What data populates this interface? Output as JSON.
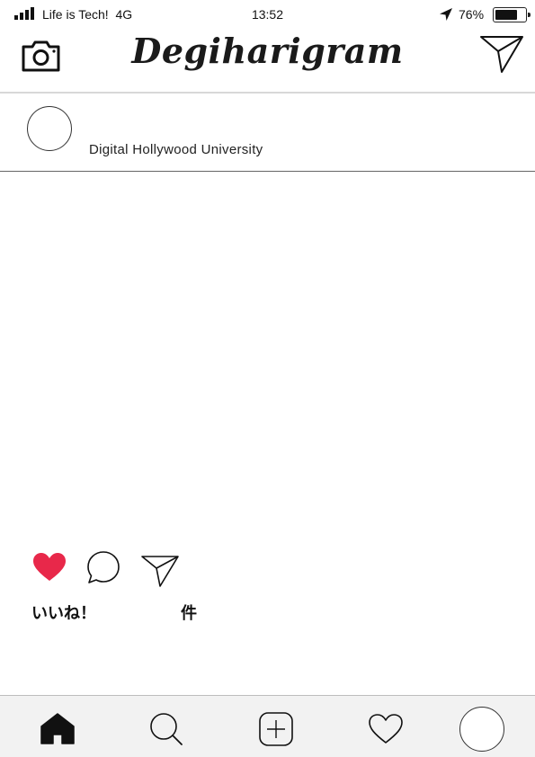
{
  "status_bar": {
    "carrier": "Life is Tech!",
    "network": "4G",
    "time": "13:52",
    "battery_percent": "76%",
    "battery_level": 0.76,
    "signal_bars": 4
  },
  "header": {
    "title": "Degiharigram",
    "left_icon": "camera-icon",
    "right_icon": "paper-plane-icon"
  },
  "post": {
    "username": "Digital Hollywood University",
    "avatar_icon": "avatar",
    "liked": true,
    "like_icon": "heart-icon",
    "comment_icon": "speech-bubble-icon",
    "share_icon": "paper-plane-icon",
    "likes_label": "いいね！",
    "likes_count": "",
    "likes_unit": "件"
  },
  "tab_bar": {
    "items": [
      {
        "icon": "home-icon",
        "active": true
      },
      {
        "icon": "search-icon",
        "active": false
      },
      {
        "icon": "add-post-icon",
        "active": false
      },
      {
        "icon": "heart-outline-icon",
        "active": false
      },
      {
        "icon": "profile-avatar",
        "active": false
      }
    ]
  },
  "colors": {
    "like_red": "#e8284a",
    "tab_bar_bg": "#f2f2f2",
    "text": "#111111"
  }
}
